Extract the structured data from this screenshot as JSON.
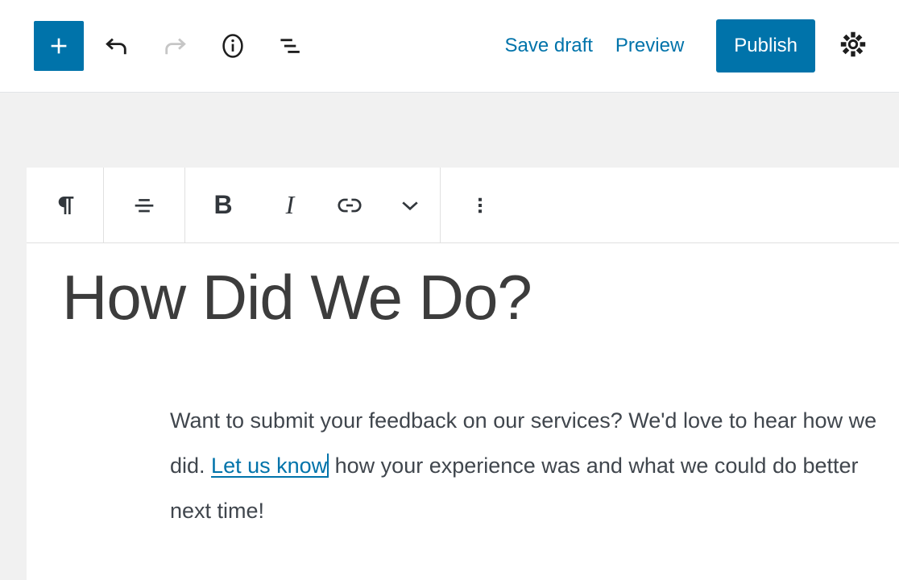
{
  "header": {
    "add_block": {
      "icon": "plus-icon",
      "label": "Add block"
    },
    "undo": {
      "icon": "undo-icon",
      "label": "Undo",
      "state": "enabled"
    },
    "redo": {
      "icon": "redo-icon",
      "label": "Redo",
      "state": "disabled"
    },
    "info": {
      "icon": "info-icon",
      "label": "Details"
    },
    "list_view": {
      "icon": "list-view-icon",
      "label": "List view"
    },
    "save_draft_label": "Save draft",
    "preview_label": "Preview",
    "publish_label": "Publish",
    "settings": {
      "icon": "gear-icon",
      "label": "Settings"
    }
  },
  "block_toolbar": {
    "block_type": {
      "icon": "paragraph-icon",
      "label": "Paragraph"
    },
    "align": {
      "icon": "align-center-icon",
      "label": "Change alignment"
    },
    "bold": {
      "glyph": "B",
      "label": "Bold"
    },
    "italic": {
      "glyph": "I",
      "label": "Italic"
    },
    "link": {
      "icon": "link-icon",
      "label": "Link"
    },
    "more_formats": {
      "icon": "chevron-down-icon",
      "label": "More rich text controls"
    },
    "more_options": {
      "icon": "more-vertical-icon",
      "label": "Options"
    }
  },
  "post": {
    "title": "How Did We Do?",
    "paragraph": {
      "before_link": "Want to submit your feedback on our services? We'd love to hear how we did. ",
      "link_text": "Let us know",
      "after_link": " how your experience was and what we could do better next time!"
    }
  },
  "colors": {
    "accent_blue": "#0073aa",
    "page_background": "#f1f1f1",
    "surface": "#ffffff",
    "text_dark": "#3c3c3c",
    "body_text": "#40464d",
    "border": "#e0e0e0",
    "disabled_icon": "#c6c6c6"
  }
}
